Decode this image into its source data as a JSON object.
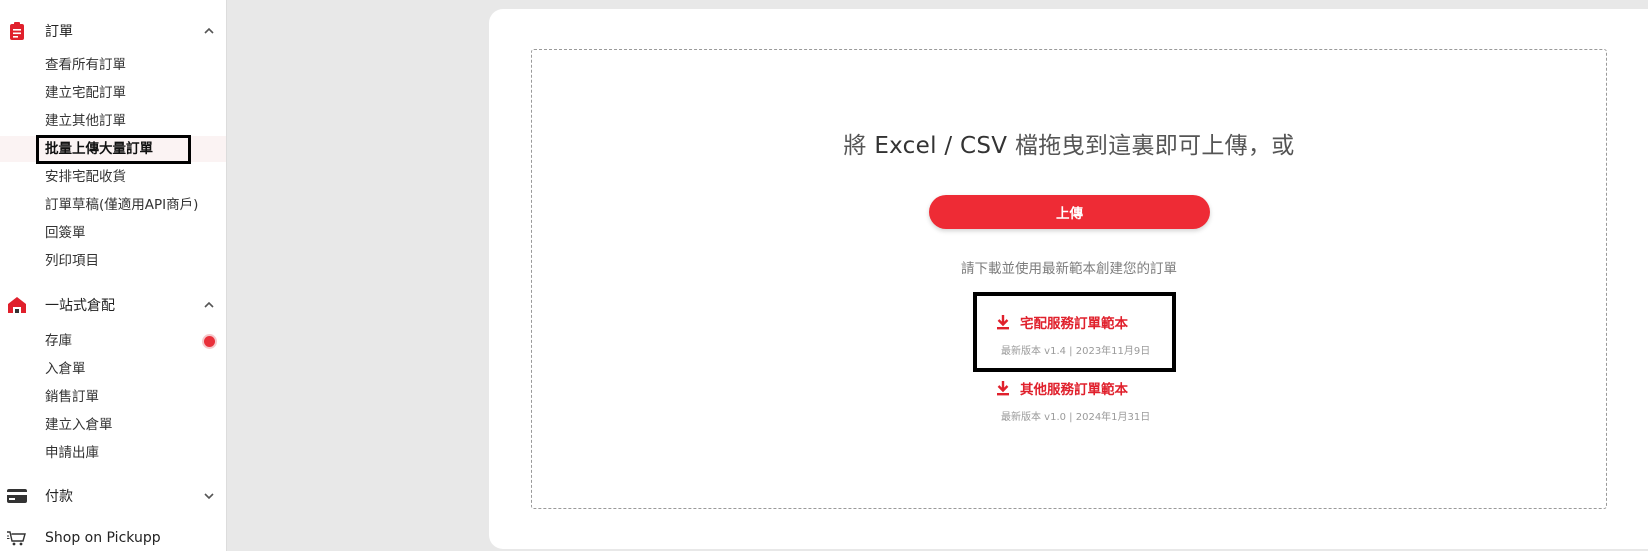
{
  "sidebar": {
    "orders": {
      "title": "訂單",
      "items": [
        {
          "label": "查看所有訂單"
        },
        {
          "label": "建立宅配訂單"
        },
        {
          "label": "建立其他訂單"
        },
        {
          "label": "批量上傳大量訂單"
        },
        {
          "label": "安排宅配收貨"
        },
        {
          "label": "訂單草稿(僅適用API商戶)"
        },
        {
          "label": "回簽單"
        },
        {
          "label": "列印項目"
        }
      ]
    },
    "warehouse": {
      "title": "一站式倉配",
      "items": [
        {
          "label": "存庫"
        },
        {
          "label": "入倉單"
        },
        {
          "label": "銷售訂單"
        },
        {
          "label": "建立入倉單"
        },
        {
          "label": "申請出庫"
        }
      ]
    },
    "payment": {
      "title": "付款"
    },
    "shop": {
      "title": "Shop on Pickupp"
    }
  },
  "upload": {
    "headline_prefix": "將 ",
    "headline_em": "Excel / CSV",
    "headline_suffix": " 檔拖曳到這裏即可上傳，或",
    "button_label": "上傳",
    "hint": "請下載並使用最新範本創建您的訂單",
    "templates": [
      {
        "label": "宅配服務訂單範本",
        "meta": "最新版本 v1.4 | 2023年11月9日"
      },
      {
        "label": "其他服務訂單範本",
        "meta": "最新版本 v1.0 | 2024年1月31日"
      }
    ]
  },
  "colors": {
    "accent": "#ee2b35",
    "link": "#e0202c"
  }
}
